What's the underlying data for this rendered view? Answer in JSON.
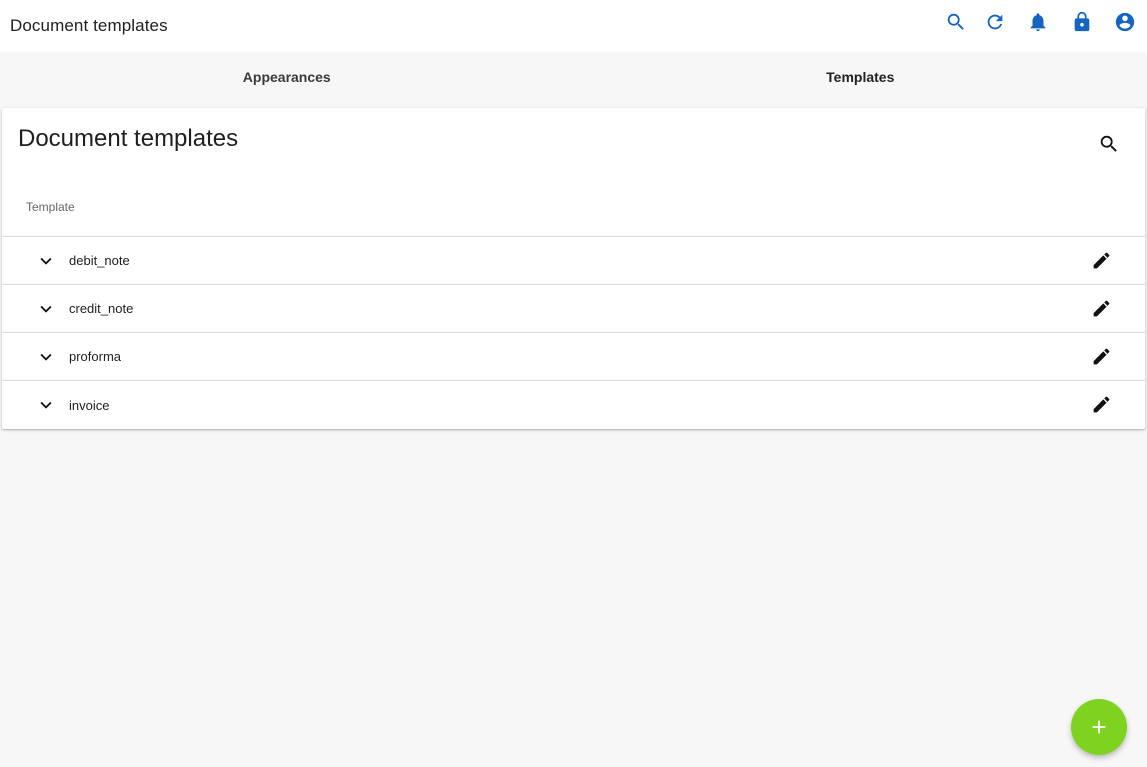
{
  "header": {
    "title": "Document templates",
    "accent_color": "#1565c0",
    "icons": [
      "search-icon",
      "refresh-icon",
      "bell-icon",
      "lock-icon",
      "account-icon"
    ]
  },
  "tabs": [
    {
      "label": "Appearances",
      "active": false
    },
    {
      "label": "Templates",
      "active": true
    }
  ],
  "card": {
    "title": "Document templates",
    "column_header": "Template",
    "rows": [
      {
        "name": "debit_note"
      },
      {
        "name": "credit_note"
      },
      {
        "name": "proforma"
      },
      {
        "name": "invoice"
      }
    ]
  },
  "fab": {
    "icon": "plus-icon",
    "color": "#7ed321"
  }
}
